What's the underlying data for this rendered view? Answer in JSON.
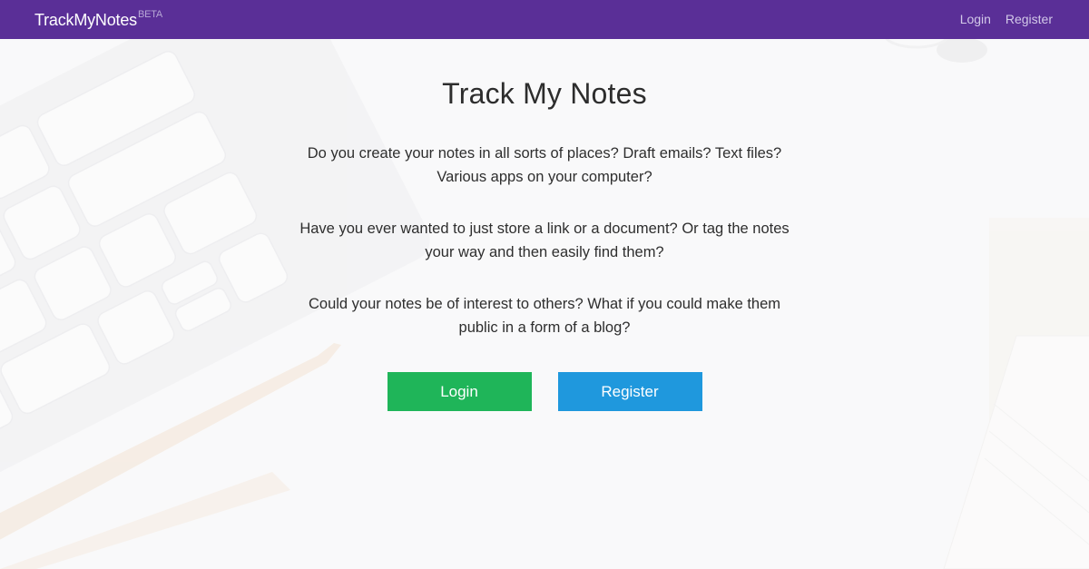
{
  "navbar": {
    "brand": "TrackMyNotes",
    "badge": "BETA",
    "links": [
      {
        "label": "Login"
      },
      {
        "label": "Register"
      }
    ]
  },
  "hero": {
    "title": "Track My Notes",
    "paragraphs": [
      "Do you create your notes in all sorts of places? Draft emails? Text files? Various apps on your computer?",
      "Have you ever wanted to just store a link or a document? Or tag the notes your way and then easily find them?",
      "Could your notes be of interest to others? What if you could make them public in a form of a blog?"
    ],
    "buttons": {
      "login": "Login",
      "register": "Register"
    }
  },
  "colors": {
    "navbar": "#5a2f97",
    "login_button": "#1fb559",
    "register_button": "#1f98dd"
  },
  "background_image": "faded desk photo with keyboard, pen and notepad"
}
